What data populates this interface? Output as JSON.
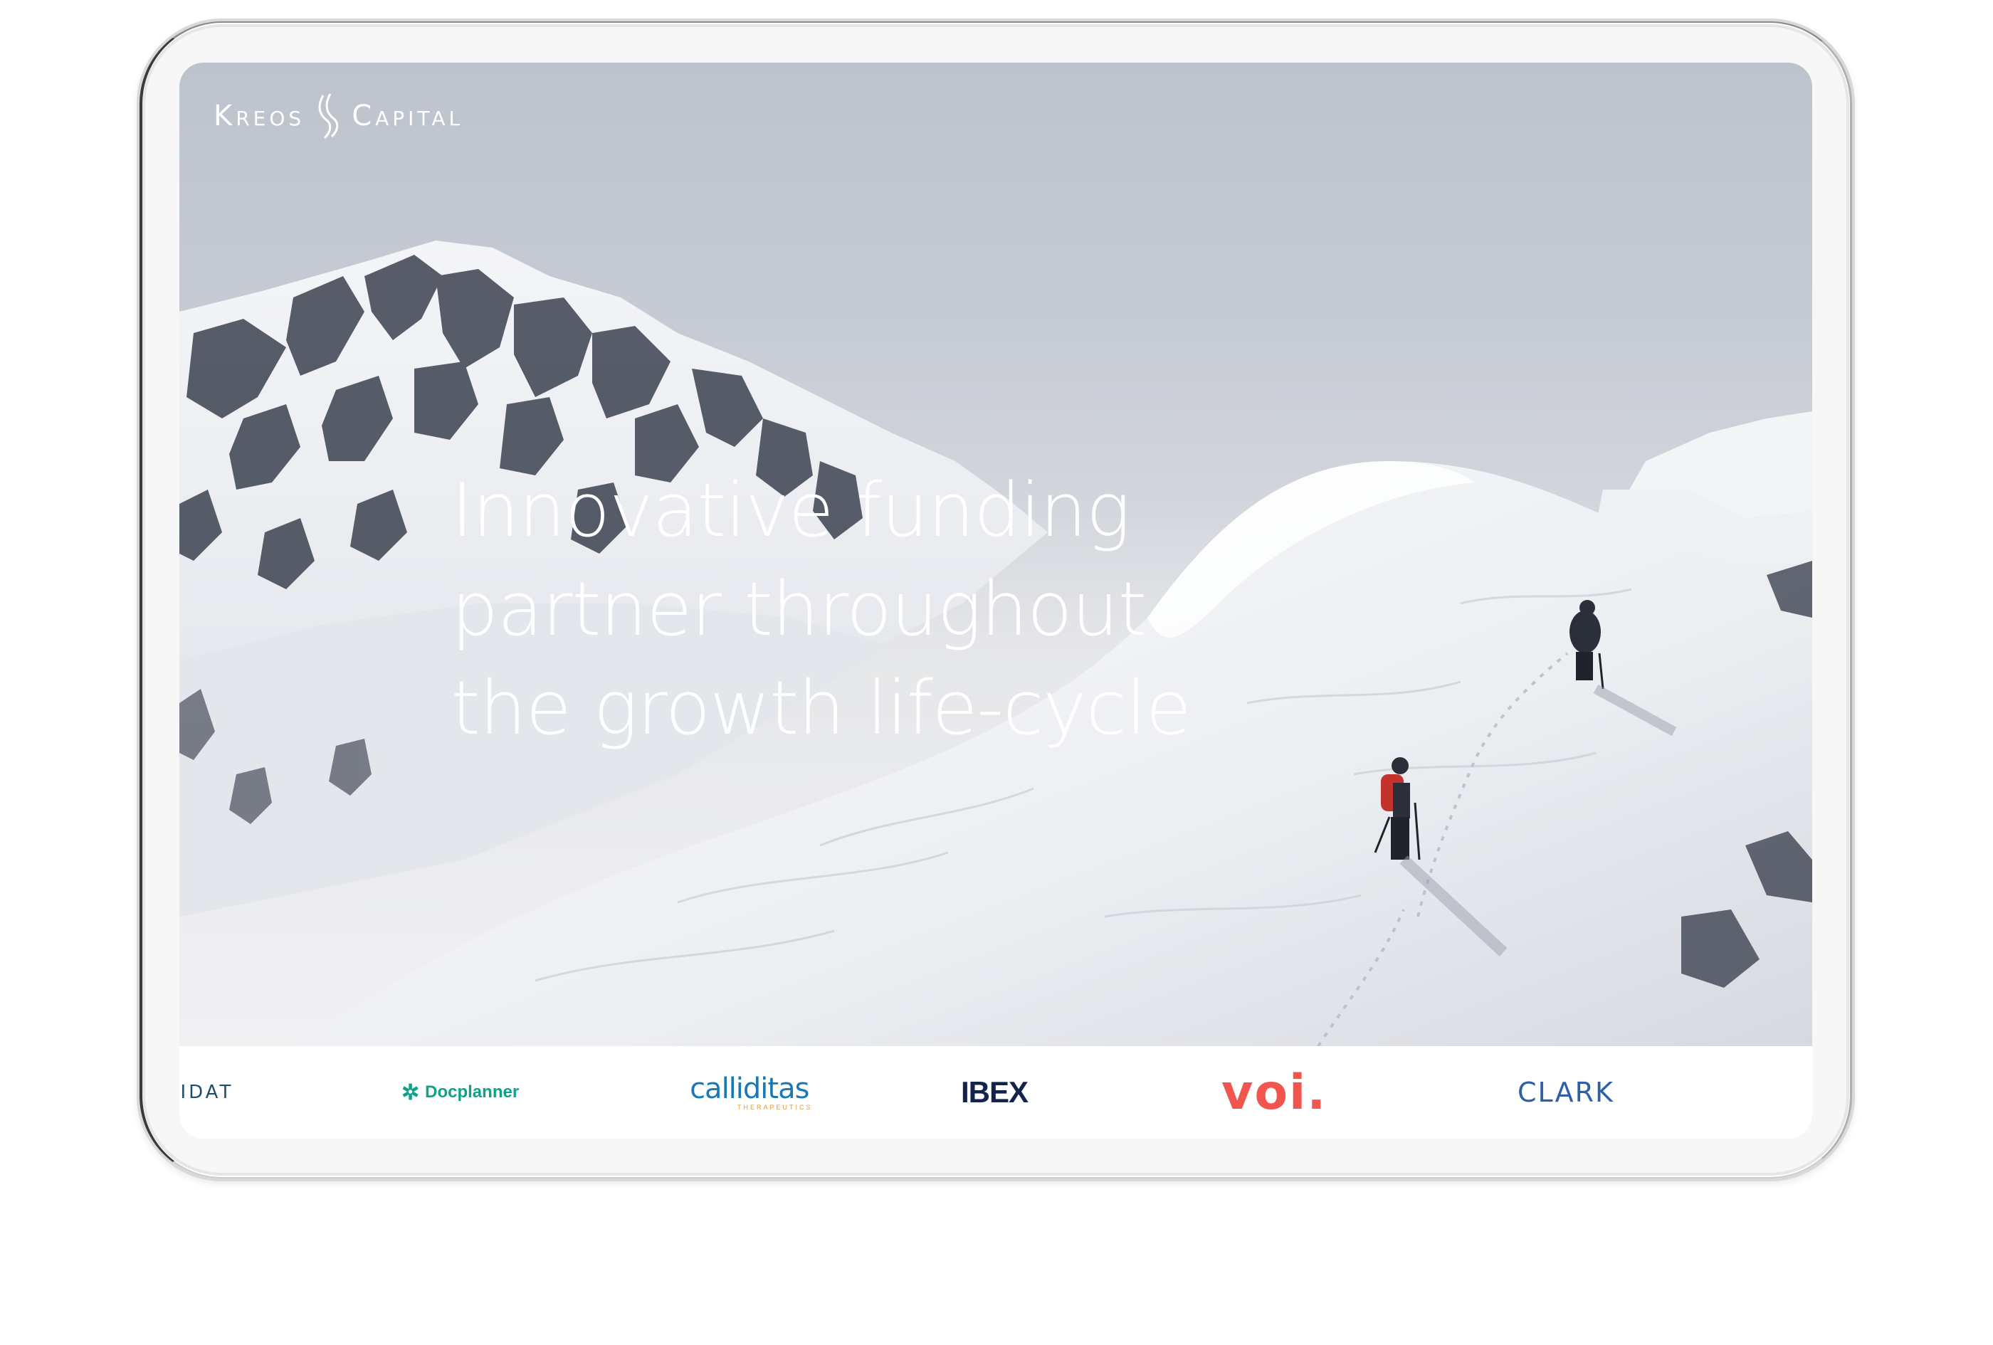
{
  "site": {
    "logo": {
      "left_word": "Kreos",
      "right_word": "Capital"
    },
    "hero": {
      "headline_lines": [
        "Innovative funding",
        "partner throughout",
        "the growth life-cycle"
      ]
    },
    "portfolio_logos": [
      {
        "name": "nidat",
        "text": "NIDAT"
      },
      {
        "name": "docplanner",
        "text": "Docplanner"
      },
      {
        "name": "calliditas",
        "text": "calliditas",
        "subtext": "THERAPEUTICS"
      },
      {
        "name": "ibex",
        "text": "IBEX"
      },
      {
        "name": "voi",
        "text": "voi."
      },
      {
        "name": "clark",
        "text": "CLARK"
      }
    ]
  },
  "colors": {
    "sky": "#bdc3cd",
    "snow": "#f0f0f2",
    "docplanner": "#10a18a",
    "calliditas": "#1a78b4",
    "ibex": "#14234a",
    "voi": "#f2554e",
    "clark": "#2f5fa6"
  }
}
